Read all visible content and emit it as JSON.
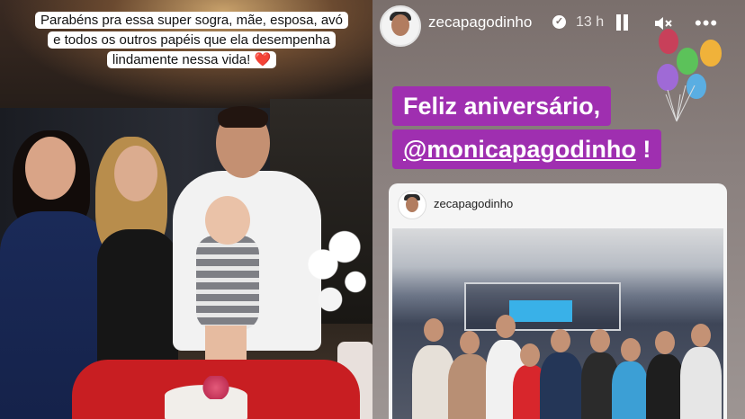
{
  "left_panel": {
    "caption_lines": [
      "Parabéns pra essa super sogra, mãe, esposa, avó",
      "e todos os outros papéis que ela desempenha",
      "lindamente nessa vida! ❤️"
    ]
  },
  "story": {
    "username": "zecapagodinho",
    "verified_mark": "✓",
    "time_ago": "13 h",
    "more_glyph": "•••",
    "greeting_line1": "Feliz aniversário,",
    "mention": "@monicapagodinho",
    "greeting_suffix": " !",
    "shared_post": {
      "username": "zecapagodinho"
    },
    "colors": {
      "greeting_bg": "#9f2fb0",
      "heart": "#e0242e"
    },
    "icons": [
      "pause-icon",
      "mute-icon",
      "more-icon",
      "verified-badge-icon",
      "balloons-sticker"
    ]
  }
}
